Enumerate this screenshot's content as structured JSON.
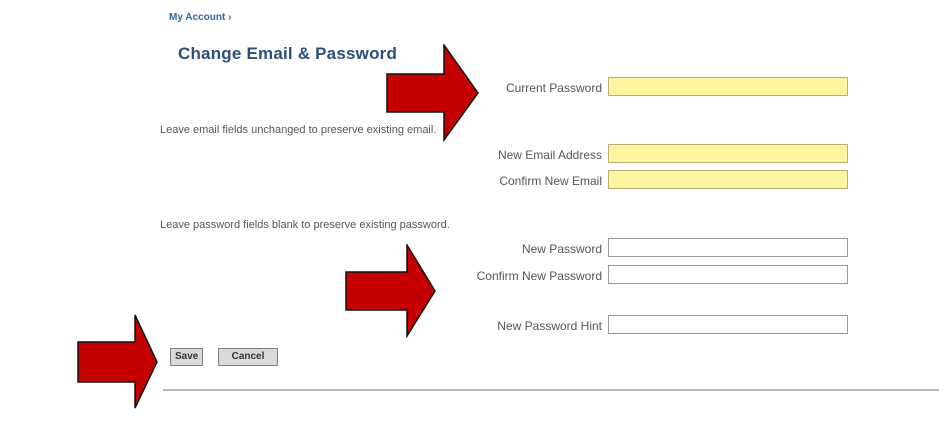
{
  "breadcrumb": "My Account ›",
  "title": "Change Email & Password",
  "fields": {
    "current_password": {
      "label": "Current Password",
      "value": ""
    },
    "new_email": {
      "label": "New Email Address",
      "value": ""
    },
    "confirm_email": {
      "label": "Confirm New Email",
      "value": ""
    },
    "new_password": {
      "label": "New Password",
      "value": ""
    },
    "confirm_password": {
      "label": "Confirm New Password",
      "value": ""
    },
    "password_hint": {
      "label": "New Password Hint",
      "value": ""
    }
  },
  "notes": {
    "email": "Leave email fields unchanged to preserve existing email.",
    "password": "Leave password fields blank to preserve existing password."
  },
  "buttons": {
    "save": "Save",
    "cancel": "Cancel"
  },
  "colors": {
    "highlight_field": "#fdf6a0",
    "title": "#2b4f78",
    "arrow": "#c40000"
  }
}
